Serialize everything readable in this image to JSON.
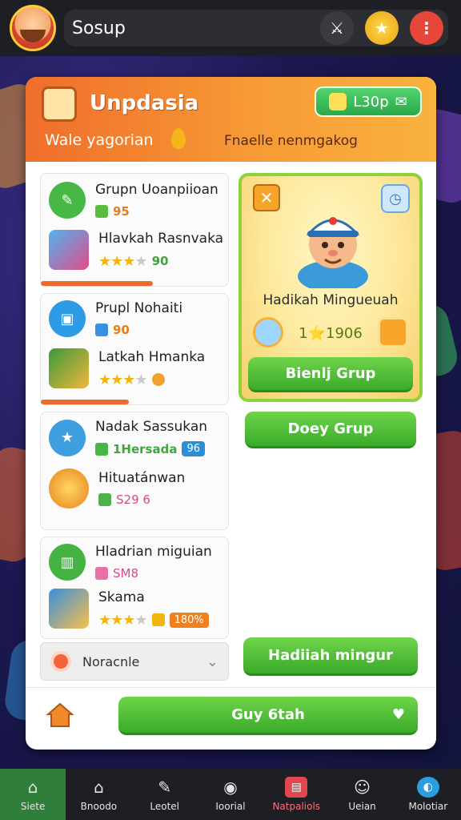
{
  "topbar": {
    "search_text": "Sosup",
    "colors": {
      "bar": "#1e1f24",
      "gold": "#e8a416",
      "red": "#e7473a"
    }
  },
  "header": {
    "title": "Unpdasia",
    "pill_label": "L30p",
    "sub_left": "Wale yagorian",
    "sub_right": "Fnaelle nenmgakog"
  },
  "list": [
    {
      "title": "Grupn Uoanpiioan",
      "meta": "95",
      "item_title": "Hlavkah Rasnvaka",
      "stars_on": 3,
      "stars_total": 4,
      "item_meta": "90",
      "progress": 0.6
    },
    {
      "title": "Prupl Nohaiti",
      "meta": "90",
      "item_title": "Latkah Hmanka",
      "stars_on": 3,
      "stars_total": 4,
      "progress": 0.5
    },
    {
      "title": "Nadak Sassukan",
      "meta": "1Hersada",
      "meta_badge": "96",
      "item_title": "Hituatánwan",
      "item_meta": "S29 6"
    },
    {
      "title": "Hladrian miguian",
      "meta": "SM8",
      "item_title": "Skama",
      "stars_on": 3,
      "stars_total": 4,
      "item_badge": "180%"
    }
  ],
  "dropdown": {
    "label": "Noracnle"
  },
  "reward": {
    "name": "Hadikah Minguеuah",
    "count": "1⭐1906",
    "claim_label": "Bienlj Grup"
  },
  "buttons": {
    "dosy_label": "Doey Grup",
    "hadiah_label": "Hadiiah mingur",
    "guy_label": "Guy 6tah"
  },
  "nav": [
    {
      "label": "Siete",
      "icon": "home-icon"
    },
    {
      "label": "Bnoodo",
      "icon": "house-icon"
    },
    {
      "label": "Leotel",
      "icon": "brush-icon"
    },
    {
      "label": "Ioorial",
      "icon": "circle-icon"
    },
    {
      "label": "Natpaliols",
      "icon": "ticket-icon"
    },
    {
      "label": "Ueian",
      "icon": "user-icon"
    },
    {
      "label": "Molotiar",
      "icon": "globe-icon"
    }
  ]
}
